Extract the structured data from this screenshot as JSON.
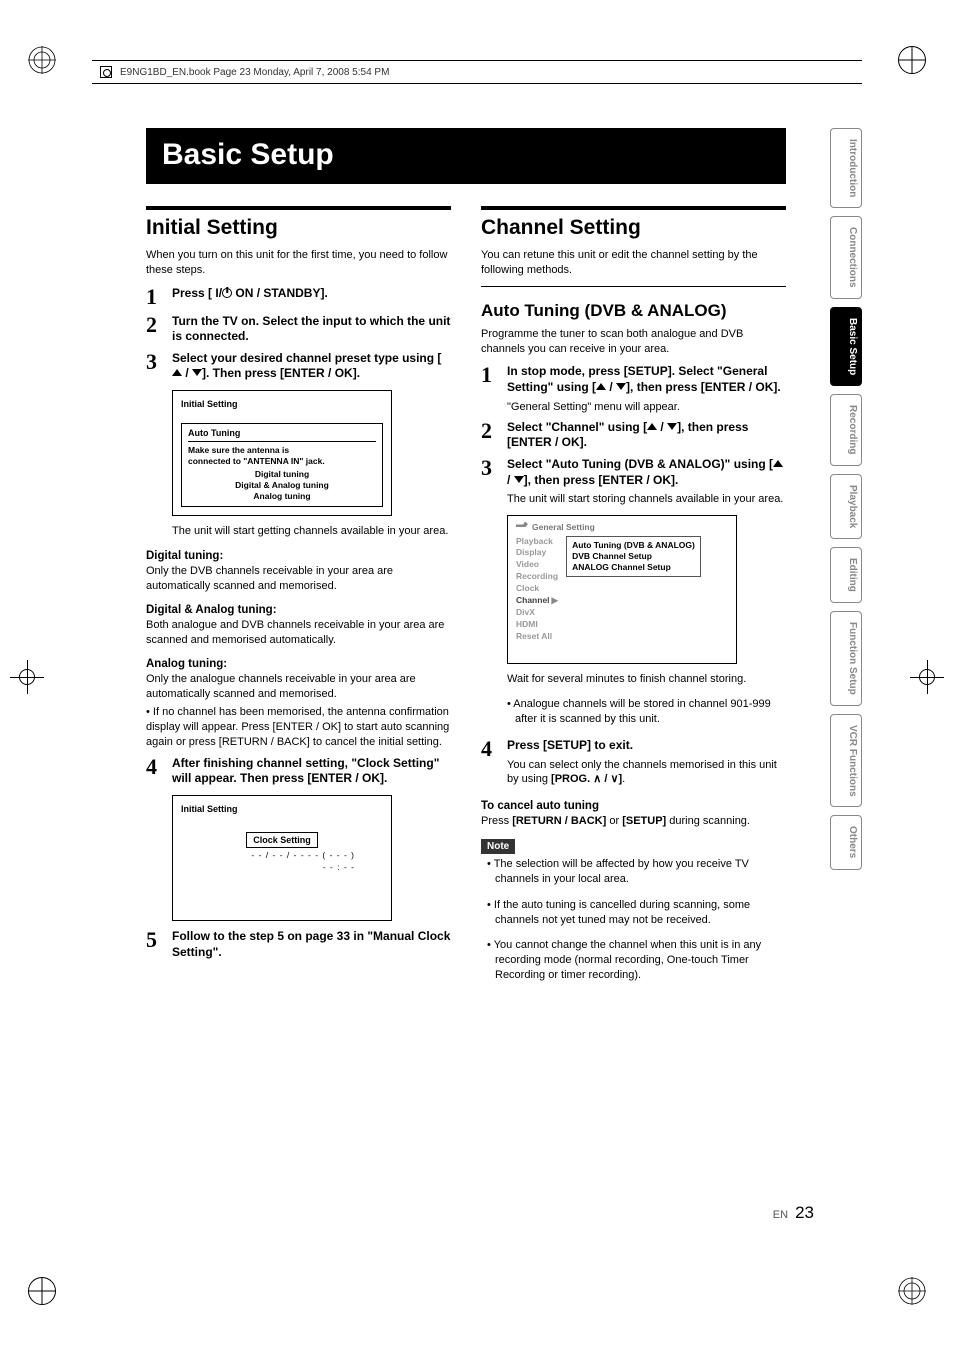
{
  "runhead": "E9NG1BD_EN.book  Page 23  Monday, April 7, 2008  5:54 PM",
  "tabs": [
    "Introduction",
    "Connections",
    "Basic Setup",
    "Recording",
    "Playback",
    "Editing",
    "Function Setup",
    "VCR Functions",
    "Others"
  ],
  "active_tab_index": 2,
  "title": "Basic Setup",
  "footer": {
    "lang": "EN",
    "page": "23"
  },
  "left": {
    "heading": "Initial Setting",
    "intro": "When you turn on this unit for the first time, you need to follow these steps.",
    "steps": {
      "s1": "Press [ I/",
      "s1b": " ON / STANDBY].",
      "s2": "Turn the TV on. Select the input to which the unit is connected.",
      "s3": "Select your desired channel preset type using [",
      "s3b": " / ",
      "s3c": "]. Then press [ENTER / OK].",
      "s4": "After finishing channel setting, \"Clock Setting\" will appear. Then press [ENTER / OK].",
      "s5": "Follow to the step 5 on page 33 in \"Manual Clock Setting\"."
    },
    "after_osd1": "The unit will start getting channels available in your area.",
    "digital_h": "Digital tuning:",
    "digital_b": "Only the DVB channels receivable in your area are automatically scanned and memorised.",
    "danda_h": "Digital & Analog tuning:",
    "danda_b": "Both analogue and DVB channels receivable in your area are scanned and memorised automatically.",
    "analog_h": "Analog tuning:",
    "analog_b": "Only the analogue channels receivable in your area are automatically scanned and memorised.",
    "nochan": "• If no channel has been memorised, the antenna confirmation display will appear. Press [ENTER / OK] to start auto scanning again or press [RETURN / BACK] to cancel the initial setting.",
    "osd1": {
      "title": "Initial Setting",
      "header": "Auto Tuning",
      "msg1": "Make sure the antenna is",
      "msg2": "connected to \"ANTENNA IN\" jack.",
      "opt1": "Digital tuning",
      "opt2": "Digital & Analog tuning",
      "opt3": "Analog tuning"
    },
    "osd2": {
      "title": "Initial Setting",
      "header": "Clock Setting",
      "val": "- -  /  - -  /  - - - -   ( - - - )",
      "val2": "- - : - -"
    }
  },
  "right": {
    "heading": "Channel Setting",
    "intro": "You can retune this unit or edit the channel setting by the following methods.",
    "sub_heading": "Auto Tuning (DVB & ANALOG)",
    "sub_intro": "Programme the tuner to scan both analogue and DVB channels you can receive in your area.",
    "steps": {
      "s1": "In stop mode, press [SETUP]. Select \"General Setting\" using [",
      "s1b": " / ",
      "s1c": "], then press [ENTER / OK].",
      "s1_after": "\"General Setting\" menu will appear.",
      "s2": "Select \"Channel\" using [",
      "s2b": " / ",
      "s2c": "], then press [ENTER / OK].",
      "s3": "Select \"Auto Tuning (DVB & ANALOG)\" using [",
      "s3b": " / ",
      "s3c": "], then press [ENTER / OK].",
      "s3_after": "The unit will start storing channels available in your area.",
      "s4": "Press [SETUP] to exit.",
      "s4_after1": "You can select only the channels memorised in this unit by using ",
      "s4_after2": "[PROG. ",
      "s4_after3": " / ",
      "s4_after4": "]",
      "s4_after5": "."
    },
    "osd3": {
      "title": "General Setting",
      "menu": [
        "Playback",
        "Display",
        "Video",
        "Recording",
        "Clock",
        "Channel",
        "DivX",
        "HDMI",
        "Reset All"
      ],
      "sel_index": 5,
      "panel": [
        "Auto Tuning (DVB & ANALOG)",
        "DVB Channel Setup",
        "ANALOG Channel Setup"
      ]
    },
    "after_osd3_1": "Wait for several minutes to finish channel storing.",
    "after_osd3_2": "• Analogue channels will be stored in channel 901-999 after it is scanned by this unit.",
    "cancel_h": "To cancel auto tuning",
    "cancel_b1": "Press ",
    "cancel_b2": "[RETURN / BACK]",
    "cancel_b3": " or ",
    "cancel_b4": "[SETUP]",
    "cancel_b5": " during scanning.",
    "note_label": "Note",
    "notes": [
      "• The selection will be affected by how you receive TV channels in your local area.",
      "• If the auto tuning is cancelled during scanning, some channels not yet tuned may not be received.",
      "• You cannot change the channel when this unit is in any recording mode (normal recording, One-touch Timer Recording or timer recording)."
    ]
  }
}
